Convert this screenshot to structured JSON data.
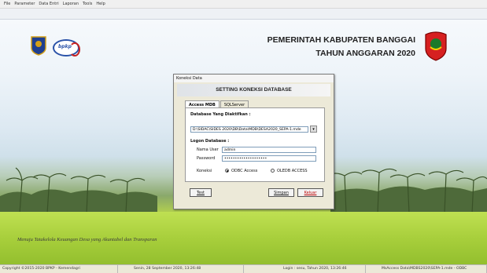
{
  "menu": [
    "File",
    "Parameter",
    "Data Entri",
    "Laporan",
    "Tools",
    "Help"
  ],
  "header": {
    "line1": "PEMERINTAH KABUPATEN BANGGAI",
    "line2": "TAHUN ANGGARAN 2020",
    "logo_text": "bpkp"
  },
  "motto": "Menuju Tatakelola Keuangan Desa yang Akuntabel dan Transparan",
  "dialog": {
    "title": "Koneksi Data",
    "banner": "SETTING KONEKSI DATABASE",
    "tabs": [
      "Access MDB",
      "SQLServer"
    ],
    "active_tab": "Access MDB",
    "db_label": "Database Yang Diaktifkan :",
    "db_path": "D:\\SIDAC\\SIDES 2020\\DB\\Data\\MDB\\DESA2020_SEPA-1.mde",
    "login_label": "Logon Database :",
    "user_label": "Nama User",
    "user_value": "admin",
    "password_label": "Password",
    "password_value": "••••••••••••••••••••",
    "connection_label": "Koneksi",
    "option_odbc": "ODBC Access",
    "option_oledb": "OLEDB ACCESS",
    "test_button": "Test",
    "save_button": "Simpan",
    "exit_button": "Keluar"
  },
  "status": [
    "Copyright ©2015-2020 BPKP - Kemendagri",
    "Senin, 28 September 2020, 13:26:48",
    "Login : sesu, Tahun 2020, 13:26:46",
    "MsAccess Data\\MDBS2020\\SEPA-1.mde - ODBC"
  ],
  "colors": {
    "dialog_bg": "#ece9d8",
    "field_green": "#a8cf3c",
    "accent_red": "#b00000"
  }
}
